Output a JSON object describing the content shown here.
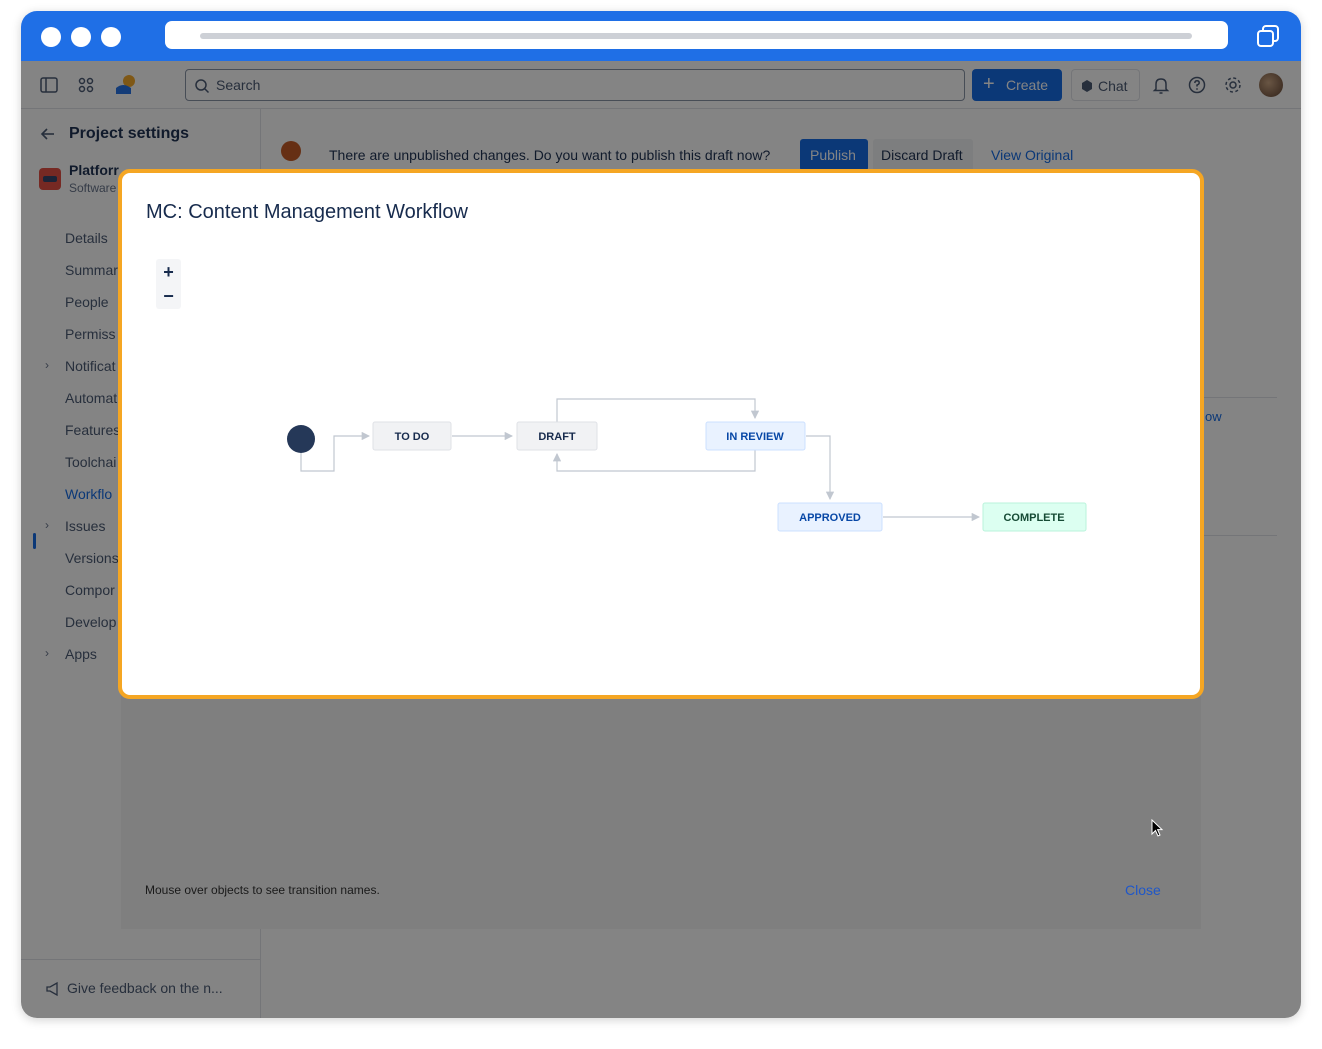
{
  "search": {
    "placeholder": "Search"
  },
  "topnav": {
    "create_label": "Create",
    "chat_label": "Chat"
  },
  "sidebar": {
    "title": "Project settings",
    "project_name": "Platforr",
    "project_type": "Software",
    "items": [
      {
        "label": "Details",
        "expandable": false
      },
      {
        "label": "Summar",
        "expandable": false
      },
      {
        "label": "People",
        "expandable": false
      },
      {
        "label": "Permiss",
        "expandable": false
      },
      {
        "label": "Notificat",
        "expandable": true
      },
      {
        "label": "Automat",
        "expandable": false
      },
      {
        "label": "Features",
        "expandable": false
      },
      {
        "label": "Toolchai",
        "expandable": false
      },
      {
        "label": "Workflo",
        "expandable": false,
        "active": true
      },
      {
        "label": "Issues",
        "expandable": true
      },
      {
        "label": "Versions",
        "expandable": false
      },
      {
        "label": "Compor",
        "expandable": false
      },
      {
        "label": "Develop",
        "expandable": false
      },
      {
        "label": "Apps",
        "expandable": true
      }
    ],
    "feedback_label": "Give feedback on the n..."
  },
  "banner": {
    "text": "There are unpublished changes. Do you want to publish this draft now?",
    "publish_label": "Publish",
    "discard_label": "Discard Draft",
    "view_original_label": "View Original"
  },
  "background": {
    "partial_link": "ow"
  },
  "dialog": {
    "title": "MC: Content Management Workflow",
    "zoom_in": "+",
    "zoom_out": "−",
    "hint": "Mouse over objects to see transition names.",
    "close_label": "Close",
    "statuses": [
      {
        "id": "todo",
        "label": "TO DO",
        "category": "todo"
      },
      {
        "id": "draft",
        "label": "DRAFT",
        "category": "todo"
      },
      {
        "id": "review",
        "label": "IN REVIEW",
        "category": "in-progress"
      },
      {
        "id": "approved",
        "label": "APPROVED",
        "category": "in-progress"
      },
      {
        "id": "complete",
        "label": "COMPLETE",
        "category": "done"
      }
    ]
  },
  "colors": {
    "accent": "#0c66e4",
    "chrome": "#1f6fe6",
    "dialog_border": "#f5a623",
    "todo_fill": "#f1f2f4",
    "inprogress_fill": "#e9f2ff",
    "done_fill": "#dcfff1"
  }
}
